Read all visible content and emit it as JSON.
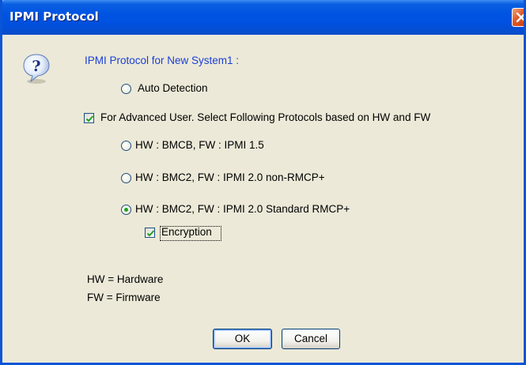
{
  "window": {
    "title": "IPMI Protocol"
  },
  "dialog": {
    "heading": "IPMI Protocol for New System1 :",
    "auto_detection_label": "Auto Detection",
    "advanced_label": "For Advanced User. Select Following Protocols based on HW and FW",
    "advanced_checked": true,
    "protocols": [
      {
        "label": "HW : BMCB,  FW : IPMI 1.5",
        "selected": false
      },
      {
        "label": "HW : BMC2,  FW : IPMI 2.0 non-RMCP+",
        "selected": false
      },
      {
        "label": "HW : BMC2,  FW : IPMI 2.0 Standard RMCP+",
        "selected": true
      }
    ],
    "encryption_label": "Encryption",
    "encryption_checked": true,
    "legend": [
      "HW = Hardware",
      "FW = Firmware"
    ]
  },
  "buttons": {
    "ok": "OK",
    "cancel": "Cancel"
  },
  "icons": {
    "question": "question-icon",
    "close": "close-icon"
  },
  "colors": {
    "titlebar": "#0054e3",
    "heading_text": "#1a3fd6",
    "dialog_bg": "#ece9d8"
  }
}
